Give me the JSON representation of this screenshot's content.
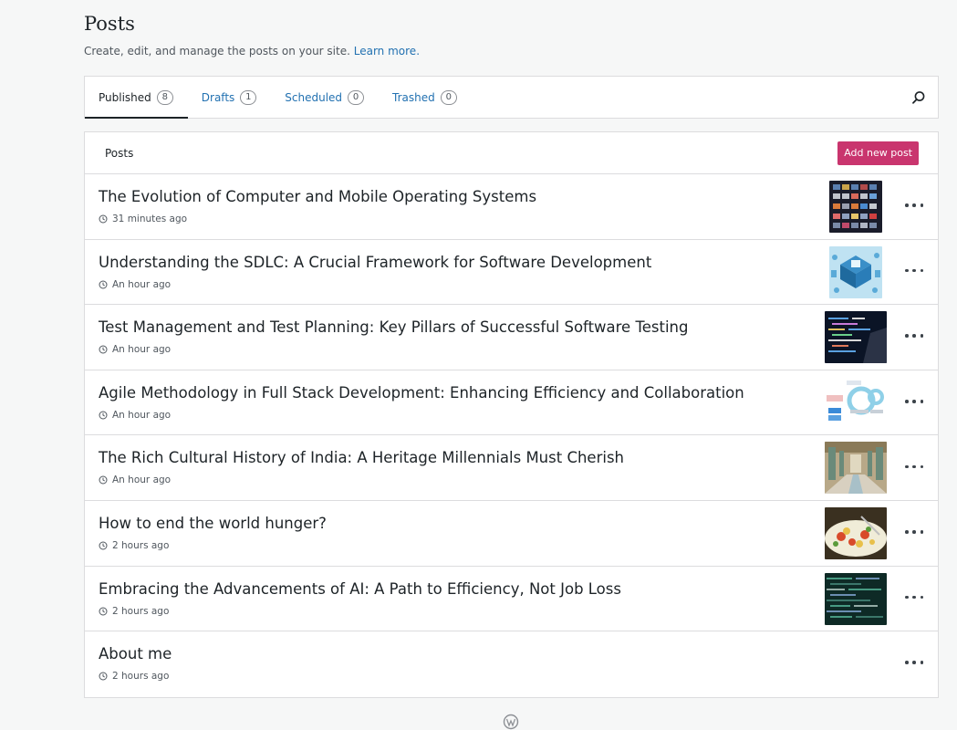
{
  "header": {
    "title": "Posts",
    "subtitle": "Create, edit, and manage the posts on your site.",
    "learn_more": "Learn more."
  },
  "tabs": [
    {
      "label": "Published",
      "count": "8",
      "active": true
    },
    {
      "label": "Drafts",
      "count": "1"
    },
    {
      "label": "Scheduled",
      "count": "0"
    },
    {
      "label": "Trashed",
      "count": "0"
    }
  ],
  "list": {
    "header_label": "Posts",
    "add_button": "Add new post",
    "posts": [
      {
        "title": "The Evolution of Computer and Mobile Operating Systems",
        "time": "31 minutes ago",
        "thumb": "grid-screens"
      },
      {
        "title": "Understanding the SDLC: A Crucial Framework for Software Development",
        "time": "An hour ago",
        "thumb": "isometric-blue"
      },
      {
        "title": "Test Management and Test Planning: Key Pillars of Successful Software Testing",
        "time": "An hour ago",
        "thumb": "code-laptop"
      },
      {
        "title": "Agile Methodology in Full Stack Development: Enhancing Efficiency and Collaboration",
        "time": "An hour ago",
        "thumb": "agile-diagram"
      },
      {
        "title": "The Rich Cultural History of India: A Heritage Millennials Must Cherish",
        "time": "An hour ago",
        "thumb": "palace-hall"
      },
      {
        "title": "How to end the world hunger?",
        "time": "2 hours ago",
        "thumb": "food-plate"
      },
      {
        "title": "Embracing the Advancements of AI: A Path to Efficiency, Not Job Loss",
        "time": "2 hours ago",
        "thumb": "code-screen"
      },
      {
        "title": "About me",
        "time": "2 hours ago",
        "thumb": ""
      }
    ]
  },
  "colors": {
    "accent": "#2271b1",
    "primary_button": "#c9356e"
  }
}
